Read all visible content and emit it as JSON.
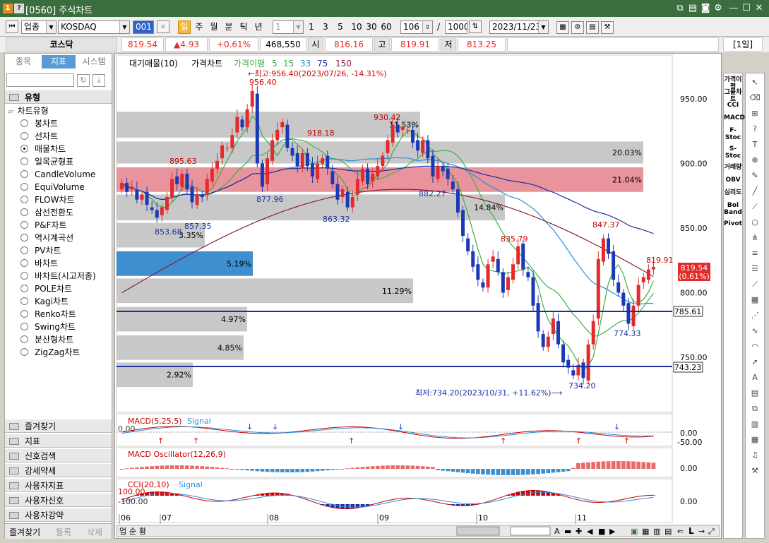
{
  "window": {
    "code": "[0560] 주식차트",
    "icon1": "1",
    "icon2": "?"
  },
  "toolbar": {
    "type_select": "업종",
    "market_select": "KOSDAQ",
    "code_input": "001",
    "period_buttons": [
      "일",
      "주",
      "월",
      "분",
      "틱",
      "년"
    ],
    "interval_select": "1",
    "quick_intervals": [
      "1",
      "3",
      "5",
      "10",
      "30",
      "60"
    ],
    "count_value": "106",
    "count_sep": "/",
    "count_total": "1000",
    "date_value": "2023/11/23"
  },
  "quote": {
    "name": "코스닥",
    "price": "819.54",
    "change": "▲4.93",
    "change_pct": "+0.61%",
    "volume": "468,550",
    "open_label": "시",
    "open": "816.16",
    "high_label": "고",
    "high": "819.91",
    "low_label": "저",
    "low": "813.25",
    "period_badge": "[1일]"
  },
  "left": {
    "tabs": [
      "종목",
      "지표",
      "시스템"
    ],
    "section_title": "유형",
    "tree_root": "차트유형",
    "items": [
      "봉차트",
      "선차트",
      "매물차트",
      "일목균형표",
      "CandleVolume",
      "EquiVolume",
      "FLOW차트",
      "삼선전환도",
      "P&F차트",
      "역시계곡선",
      "PV차트",
      "바차트",
      "바차트(시고저종)",
      "POLE차트",
      "Kagi차트",
      "Renko차트",
      "Swing차트",
      "분산형차트",
      "ZigZag차트"
    ],
    "selected_index": 2,
    "folders": [
      "즐겨찾기",
      "지표",
      "신호검색",
      "강세약세",
      "사용자지표",
      "사용자신호",
      "사용자강약"
    ],
    "bottom_buttons": [
      "즐겨찾기",
      "등록",
      "삭제"
    ]
  },
  "colors": {
    "up": "#e32b2b",
    "down": "#1a3ab5",
    "ma5": "#3fae3f",
    "ma15": "#39b54a",
    "ma33": "#2b8fd8",
    "ma75": "#1a2fa0",
    "ma150": "#8b1e3f",
    "profile_gray": "#c8c8c8",
    "profile_red": "#e9939d",
    "profile_blue": "#3d8fd0",
    "title_bar": "#3a6e3f",
    "price_tag": "#e32b2b"
  },
  "chart": {
    "legend": {
      "prefix": "대기매물(10)",
      "price_label": "가격차트",
      "ma_label": "가격이평",
      "ma_values": [
        "5",
        "15",
        "33",
        "75",
        "150"
      ]
    },
    "high_note": "←최고:956.40(2023/07/26, -14.31%)",
    "low_note": "최저:734.20(2023/10/31, +11.62%)⟶",
    "y_ticks": [
      "950.00",
      "900.00",
      "850.00",
      "800.00",
      "750.00"
    ],
    "x_labels": [
      "06",
      "07",
      "08",
      "09",
      "10",
      "11"
    ],
    "price_tag": "819.54",
    "price_tag_pct": "(0.61%)",
    "hline_labels": [
      "785.61",
      "743.23"
    ],
    "price_annotations": [
      "956.40",
      "930.42",
      "918.18",
      "895.63",
      "877.96",
      "882.27",
      "863.32",
      "853.68",
      "857.35",
      "835.79",
      "847.37",
      "819.91",
      "774.33",
      "734.20"
    ],
    "profile_pcts": [
      "11.53%",
      "20.03%",
      "21.04%",
      "14.84%",
      "3.35%",
      "5.19%",
      "11.29%",
      "4.97%",
      "4.85%",
      "2.92%"
    ],
    "macd": {
      "label": "MACD(5,25,5)",
      "signal": "Signal",
      "zero": "0.00",
      "y1": "0.00",
      "y2": "-50.00"
    },
    "macd_osc": {
      "label": "MACD Oscillator(12,26,9)",
      "y": "0.00"
    },
    "cci": {
      "label": "CCI(20,10)",
      "signal": "Signal",
      "v1": "100.00",
      "v2": "-100.00",
      "y": "0.00"
    },
    "scroll_labels": [
      "업",
      "순",
      "황"
    ]
  },
  "side1": [
    "가격이평",
    "그물차트",
    "CCI",
    "MACD",
    "F-Stoc",
    "S-Stoc",
    "거래량",
    "OBV",
    "심리도",
    "Bol Band",
    "Pivot"
  ]
}
